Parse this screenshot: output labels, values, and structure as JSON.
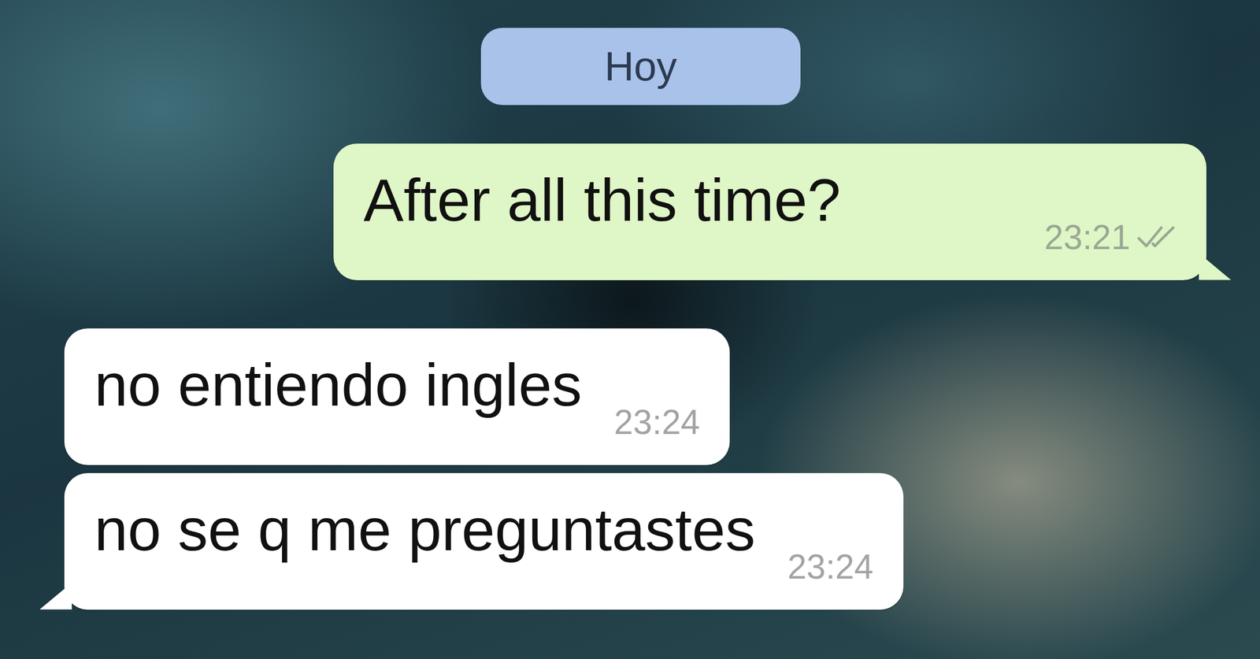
{
  "date": {
    "label": "Hoy"
  },
  "messages": [
    {
      "text": "After all this time?",
      "time": "23:21",
      "kind": "sent",
      "delivered": true
    },
    {
      "text": "no entiendo ingles",
      "time": "23:24",
      "kind": "received",
      "delivered": false
    },
    {
      "text": "no se q me preguntastes",
      "time": "23:24",
      "kind": "received",
      "delivered": false
    }
  ]
}
